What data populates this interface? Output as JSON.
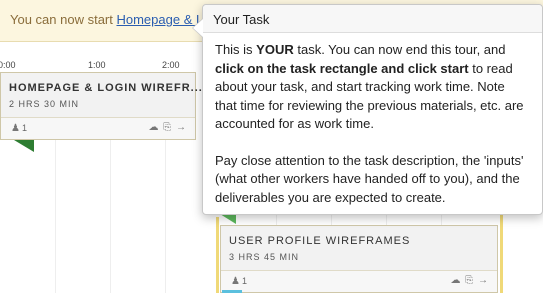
{
  "notice": {
    "prefix": "You can now start ",
    "link": "Homepage & L"
  },
  "timeline": {
    "ticks": [
      "0:00",
      "1:00",
      "2:00"
    ]
  },
  "cards": [
    {
      "title": "HOMEPAGE & LOGIN WIREFR...",
      "duration": "2 HRS 30 MIN",
      "count": "1",
      "actions": "☁ ⎘ →"
    },
    {
      "title": "USER PROFILE WIREFRAMES",
      "duration": "3 HRS 45 MIN",
      "count": "1",
      "actions": "☁ ⎘ →"
    }
  ],
  "popover": {
    "title": "Your Task",
    "p1_a": "This is ",
    "p1_b": "YOUR",
    "p1_c": " task. You can now end this tour, and ",
    "p1_d": "click on the task rectangle and click start",
    "p1_e": " to read about your task, and start tracking work time. Note that time for reviewing the previous materials, etc. are accounted for as work time.",
    "p2": "Pay close attention to the task description, the 'inputs' (what other workers have handed off to you), and the deliverables you are expected to create."
  },
  "colors": {
    "notice_bg": "#fcf6df",
    "link": "#2a5db0",
    "green_marker": "#2e7d32",
    "yellow_rail": "#f0d978"
  }
}
